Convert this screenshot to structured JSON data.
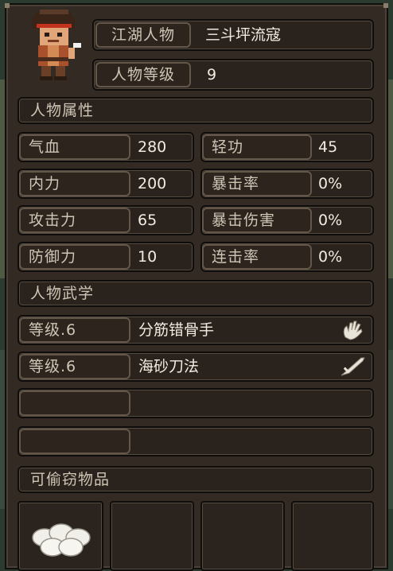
{
  "profile": {
    "name_label": "江湖人物",
    "name_value": "三斗坪流寇",
    "level_label": "人物等级",
    "level_value": "9"
  },
  "attributes": {
    "section_title": "人物属性",
    "rows": [
      {
        "left_label": "气血",
        "left_value": "280",
        "right_label": "轻功",
        "right_value": "45"
      },
      {
        "left_label": "内力",
        "left_value": "200",
        "right_label": "暴击率",
        "right_value": "0%"
      },
      {
        "left_label": "攻击力",
        "left_value": "65",
        "right_label": "暴击伤害",
        "right_value": "0%"
      },
      {
        "left_label": "防御力",
        "left_value": "10",
        "right_label": "连击率",
        "right_value": "0%"
      }
    ]
  },
  "martial": {
    "section_title": "人物武学",
    "skills": [
      {
        "level": "等级.6",
        "name": "分筋错骨手",
        "icon": "hand-icon"
      },
      {
        "level": "等级.6",
        "name": "海砂刀法",
        "icon": "blade-icon"
      },
      {
        "level": "",
        "name": "",
        "icon": ""
      },
      {
        "level": "",
        "name": "",
        "icon": ""
      }
    ]
  },
  "steal": {
    "section_title": "可偷窃物品",
    "items": [
      {
        "icon": "steamed-buns-icon"
      },
      {
        "icon": ""
      },
      {
        "icon": ""
      },
      {
        "icon": ""
      }
    ]
  }
}
